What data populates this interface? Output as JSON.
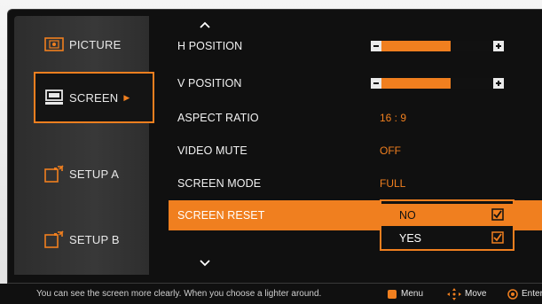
{
  "sidebar": {
    "items": [
      {
        "label": "PICTURE",
        "icon": "picture-icon"
      },
      {
        "label": "SCREEN",
        "icon": "screen-icon",
        "active": true
      },
      {
        "label": "SETUP A",
        "icon": "setup-a-icon"
      },
      {
        "label": "SETUP B",
        "icon": "setup-b-icon"
      }
    ]
  },
  "settings": {
    "h_position": {
      "label": "H POSITION",
      "level": 0.62
    },
    "v_position": {
      "label": "V POSITION",
      "level": 0.62
    },
    "aspect_ratio": {
      "label": "ASPECT RATIO",
      "value": "16 : 9"
    },
    "video_mute": {
      "label": "VIDEO MUTE",
      "value": "OFF"
    },
    "screen_mode": {
      "label": "SCREEN MODE",
      "value": "FULL"
    },
    "screen_reset": {
      "label": "SCREEN RESET"
    }
  },
  "reset_popup": {
    "options": [
      {
        "label": "NO",
        "selected": true
      },
      {
        "label": "YES",
        "selected": false
      }
    ]
  },
  "statusbar": {
    "hint": "You can see the screen more clearly.  When you choose a lighter around.",
    "menu_label": "Menu",
    "move_label": "Move",
    "enter_label": "Enter"
  },
  "colors": {
    "accent": "#f07f1f",
    "background": "#101010",
    "sidebar": "#333333",
    "text": "#f2f2f2"
  }
}
